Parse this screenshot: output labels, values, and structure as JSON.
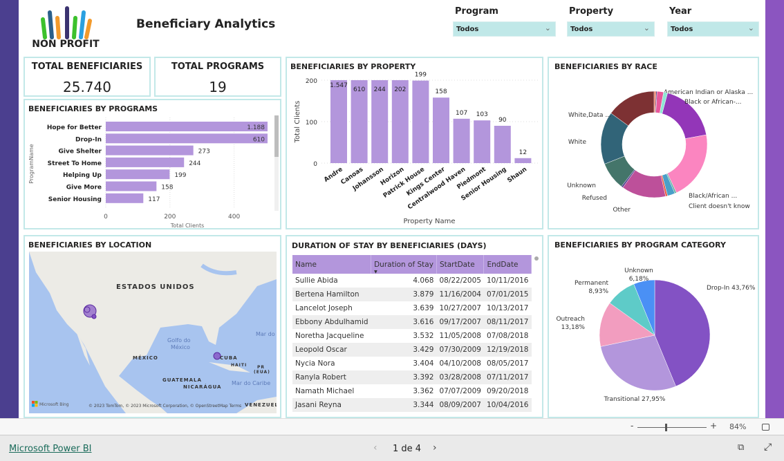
{
  "header": {
    "logo_text": "NON PROFIT",
    "title": "Beneficiary Analytics"
  },
  "slicers": [
    {
      "label": "Program",
      "value": "Todos"
    },
    {
      "label": "Property",
      "value": "Todos"
    },
    {
      "label": "Year",
      "value": "Todos"
    }
  ],
  "cards": [
    {
      "title": "TOTAL BENEFICIARIES",
      "value": "25.740"
    },
    {
      "title": "TOTAL PROGRAMS",
      "value": "19"
    }
  ],
  "colors": {
    "bar": "#b396dc",
    "border": "#c2e8e8",
    "left_strip": "#4b3f8f",
    "right_strip": "#8b55c0"
  },
  "chart_data": [
    {
      "id": "programs",
      "type": "bar",
      "orientation": "horizontal",
      "title": "BENEFICIARIES BY PROGRAMS",
      "xlabel": "Total Clients",
      "ylabel": "ProgramName",
      "categories": [
        "Hope for Better",
        "Drop-In",
        "Give Shelter",
        "Street To Home",
        "Helping Up",
        "Give More",
        "Senior Housing"
      ],
      "values": [
        1188,
        610,
        273,
        244,
        199,
        158,
        117
      ],
      "value_labels": [
        "1.188",
        "610",
        "273",
        "244",
        "199",
        "158",
        "117"
      ],
      "xticks": [
        "0",
        "200",
        "400"
      ],
      "xlim": [
        0,
        510
      ],
      "grid": true
    },
    {
      "id": "property",
      "type": "bar",
      "title": "BENEFICIARIES BY PROPERTY",
      "xlabel": "Property Name",
      "ylabel": "Total Clients",
      "categories": [
        "Andre",
        "Canoas",
        "Johansson",
        "Horizon",
        "Patrick House",
        "Kings Center",
        "Centralwood Haven",
        "Piedmont",
        "Senior Housing",
        "Shaun"
      ],
      "values": [
        1547,
        610,
        244,
        202,
        199,
        158,
        107,
        103,
        90,
        12
      ],
      "value_labels": [
        "1.547",
        "610",
        "244",
        "202",
        "199",
        "158",
        "107",
        "103",
        "90",
        "12"
      ],
      "yticks": [
        "0",
        "100",
        "200"
      ],
      "ylim": [
        0,
        200
      ],
      "grid": true
    },
    {
      "id": "race",
      "type": "pie",
      "donut": true,
      "title": "BENEFICIARIES BY RACE",
      "slices": [
        {
          "label": "American Indian or Alaska ...",
          "value": 0.6,
          "color": "#e8755a"
        },
        {
          "label": "",
          "value": 0.3,
          "color": "#3a2a7a"
        },
        {
          "label": "",
          "value": 2,
          "color": "#e8589a"
        },
        {
          "label": "",
          "value": 1.2,
          "color": "#8ee6d4"
        },
        {
          "label": "Black or African-...",
          "value": 18,
          "color": "#9336b8"
        },
        {
          "label": "Black/African ...",
          "value": 21,
          "color": "#fb85c0"
        },
        {
          "label": "Client doesn't know",
          "value": 0.5,
          "color": "#5fb0a0"
        },
        {
          "label": "",
          "value": 2.3,
          "color": "#4aa0c8"
        },
        {
          "label": "",
          "value": 0.6,
          "color": "#e85a40"
        },
        {
          "label": "Other",
          "value": 13.5,
          "color": "#bd509a"
        },
        {
          "label": "Refused",
          "value": 0.5,
          "color": "#4a3a8a"
        },
        {
          "label": "Unknown",
          "value": 8.5,
          "color": "#44756a"
        },
        {
          "label": "White",
          "value": 16,
          "color": "#316478"
        },
        {
          "label": "White,Data ...",
          "value": 15,
          "color": "#7d3133"
        }
      ]
    },
    {
      "id": "category",
      "type": "pie",
      "title": "BENEFICIARIES BY PROGRAM CATEGORY",
      "slices": [
        {
          "label": "Drop-In",
          "pct_label": "43,76%",
          "value": 43.76,
          "color": "#8352c4"
        },
        {
          "label": "Transitional",
          "pct_label": "27,95%",
          "value": 27.95,
          "color": "#b396dc"
        },
        {
          "label": "Outreach",
          "pct_label": "13,18%",
          "value": 13.18,
          "color": "#f29dbf"
        },
        {
          "label": "Permanent",
          "pct_label": "8,93%",
          "value": 8.93,
          "color": "#5ecbc8"
        },
        {
          "label": "Unknown",
          "pct_label": "6,18%",
          "value": 6.18,
          "color": "#4a90f5"
        }
      ]
    }
  ],
  "map": {
    "title": "BENEFICIARIES BY LOCATION",
    "labels": [
      "ESTADOS UNIDOS",
      "Golfo do",
      "México",
      "MÉXICO",
      "CUBA",
      "HAITI",
      "PR",
      "(EUA)",
      "GUATEMALA",
      "NICARÁGUA",
      "Mar do Caribe",
      "Mar do",
      "VENEZUELA"
    ],
    "bing": "Microsoft Bing",
    "attribution": "© 2023 TomTom, © 2023 Microsoft Corporation, © OpenStreetMap  Terms"
  },
  "table": {
    "title": "DURATION OF STAY BY BENEFICIARIES (DAYS)",
    "columns": [
      "Name",
      "Duration of Stay",
      "StartDate",
      "EndDate"
    ],
    "rows": [
      [
        "Sullie Abida",
        "4.068",
        "08/22/2005",
        "10/11/2016"
      ],
      [
        "Bertena Hamilton",
        "3.879",
        "11/16/2004",
        "07/01/2015"
      ],
      [
        "Lancelot Joseph",
        "3.639",
        "10/27/2007",
        "10/13/2017"
      ],
      [
        "Ebbony Abdulhamid",
        "3.616",
        "09/17/2007",
        "08/11/2017"
      ],
      [
        "Noretha Jacqueline",
        "3.532",
        "11/05/2008",
        "07/08/2018"
      ],
      [
        "Leopold Oscar",
        "3.429",
        "07/30/2009",
        "12/19/2018"
      ],
      [
        "Nycia Nora",
        "3.404",
        "04/10/2008",
        "08/05/2017"
      ],
      [
        "Ranyla Robert",
        "3.392",
        "03/28/2008",
        "07/11/2017"
      ],
      [
        "Namath Michael",
        "3.362",
        "07/07/2009",
        "09/20/2018"
      ],
      [
        "Jasani Reyna",
        "3.344",
        "08/09/2007",
        "10/04/2016"
      ]
    ]
  },
  "zoom": {
    "minus": "-",
    "plus": "+",
    "level": "84%",
    "level_fraction": 0.84
  },
  "footer": {
    "brand": "Microsoft Power BI",
    "page": "1 de 4"
  }
}
